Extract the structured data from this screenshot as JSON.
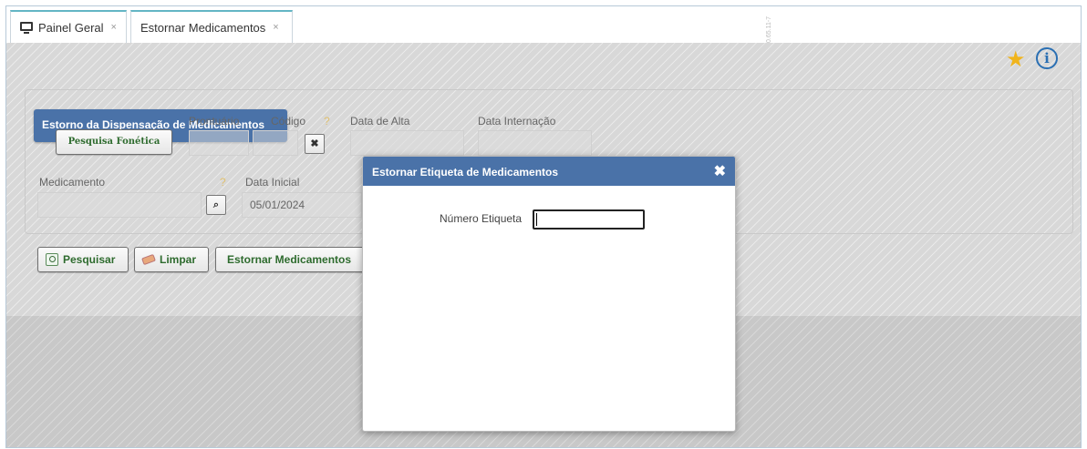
{
  "tabs": [
    {
      "label": "Painel Geral",
      "close": "×"
    },
    {
      "label": "Estornar Medicamentos",
      "close": "×"
    }
  ],
  "version_text": "0.65.11-7",
  "header_icons": {
    "favorite": "star-icon",
    "info": "info-icon",
    "info_glyph": "i"
  },
  "panel": {
    "title": "Estorno da Dispensação de Medicamentos",
    "phonetic_button": "Pesquisa Fonética",
    "prontuario_label": "Prontuário",
    "codigo_label": "Código",
    "help_mark": "?",
    "data_alta_label": "Data de Alta",
    "data_internacao_label": "Data Internação",
    "clear_code_glyph": "✖",
    "medicamento_label": "Medicamento",
    "search_glyph": "⌕",
    "data_inicial_label": "Data Inicial",
    "data_inicial_value": "05/01/2024"
  },
  "actions": {
    "pesquisar": "Pesquisar",
    "limpar": "Limpar",
    "estornar": "Estornar Medicamentos"
  },
  "modal": {
    "title": "Estornar Etiqueta de Medicamentos",
    "close_glyph": "✖",
    "field_label": "Número Etiqueta",
    "field_value": ""
  },
  "colors": {
    "accent": "#4a72a8",
    "star": "#f0b41c",
    "info": "#2a6fb3",
    "button_text": "#2e6b2e"
  }
}
